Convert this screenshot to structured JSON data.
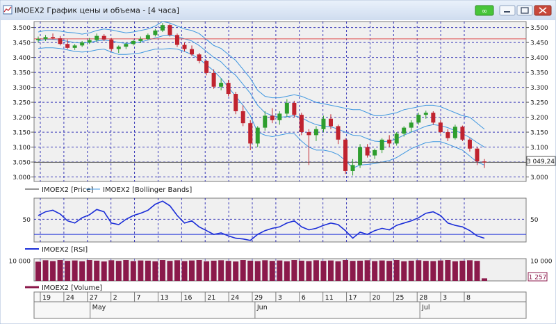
{
  "window": {
    "title": "IMOEX2 График цены и объема - [4 часа]",
    "colors": {
      "titlebar": "#ffffff",
      "frame": "#9fb6d6",
      "link_button": "#48c53a",
      "close_button": "#c8483a"
    }
  },
  "icons": {
    "app": "chart-window-icon",
    "link": "link-icon",
    "minimize": "minimize-icon",
    "maximize": "maximize-icon",
    "close": "close-icon"
  },
  "legend": {
    "price": "IMOEX2 [Price]",
    "bollinger": "IMOEX2 [Bollinger Bands]",
    "rsi": "IMOEX2 [RSI]",
    "volume": "IMOEX2 [Volume]"
  },
  "last_price_label": "3 049,24",
  "last_volume_label": "1 257",
  "colors": {
    "up_candle": "#2e9e2e",
    "down_candle": "#c0232f",
    "bollinger": "#3f97e0",
    "rsi": "#1a2dd8",
    "volume": "#8b1a4b",
    "grid": "#1c1cb0",
    "hline_price": "#e05050",
    "plot_bg": "#f0f0f0"
  },
  "chart_data": [
    {
      "type": "candlestick",
      "series": [
        {
          "name": "IMOEX2 [Price]",
          "values": [
            [
              3458,
              3470,
              3450,
              3462
            ],
            [
              3462,
              3475,
              3455,
              3468
            ],
            [
              3468,
              3480,
              3460,
              3464
            ],
            [
              3464,
              3472,
              3440,
              3445
            ],
            [
              3445,
              3460,
              3428,
              3432
            ],
            [
              3432,
              3445,
              3425,
              3440
            ],
            [
              3440,
              3455,
              3435,
              3450
            ],
            [
              3450,
              3465,
              3445,
              3458
            ],
            [
              3458,
              3480,
              3452,
              3472
            ],
            [
              3472,
              3478,
              3455,
              3460
            ],
            [
              3460,
              3465,
              3420,
              3428
            ],
            [
              3428,
              3440,
              3415,
              3436
            ],
            [
              3436,
              3450,
              3428,
              3445
            ],
            [
              3445,
              3460,
              3440,
              3455
            ],
            [
              3455,
              3470,
              3448,
              3462
            ],
            [
              3462,
              3480,
              3458,
              3475
            ],
            [
              3475,
              3495,
              3470,
              3490
            ],
            [
              3490,
              3515,
              3485,
              3508
            ],
            [
              3508,
              3512,
              3470,
              3475
            ],
            [
              3475,
              3480,
              3435,
              3442
            ],
            [
              3442,
              3450,
              3420,
              3428
            ],
            [
              3428,
              3440,
              3405,
              3410
            ],
            [
              3410,
              3415,
              3380,
              3388
            ],
            [
              3388,
              3392,
              3340,
              3348
            ],
            [
              3348,
              3360,
              3295,
              3302
            ],
            [
              3302,
              3330,
              3290,
              3315
            ],
            [
              3315,
              3325,
              3270,
              3278
            ],
            [
              3278,
              3285,
              3210,
              3220
            ],
            [
              3220,
              3240,
              3170,
              3180
            ],
            [
              3180,
              3190,
              3090,
              3112
            ],
            [
              3112,
              3170,
              3100,
              3165
            ],
            [
              3165,
              3220,
              3155,
              3205
            ],
            [
              3205,
              3230,
              3180,
              3190
            ],
            [
              3190,
              3220,
              3175,
              3212
            ],
            [
              3212,
              3260,
              3200,
              3248
            ],
            [
              3248,
              3255,
              3200,
              3208
            ],
            [
              3208,
              3215,
              3140,
              3150
            ],
            [
              3150,
              3160,
              3040,
              3140
            ],
            [
              3140,
              3170,
              3120,
              3160
            ],
            [
              3160,
              3205,
              3150,
              3195
            ],
            [
              3195,
              3210,
              3160,
              3170
            ],
            [
              3170,
              3175,
              3110,
              3125
            ],
            [
              3125,
              3130,
              3010,
              3020
            ],
            [
              3020,
              3060,
              3005,
              3040
            ],
            [
              3040,
              3110,
              3030,
              3100
            ],
            [
              3100,
              3110,
              3065,
              3072
            ],
            [
              3072,
              3095,
              3060,
              3090
            ],
            [
              3090,
              3130,
              3080,
              3125
            ],
            [
              3125,
              3140,
              3100,
              3112
            ],
            [
              3112,
              3150,
              3105,
              3145
            ],
            [
              3145,
              3170,
              3135,
              3165
            ],
            [
              3165,
              3190,
              3150,
              3182
            ],
            [
              3182,
              3215,
              3175,
              3208
            ],
            [
              3208,
              3222,
              3195,
              3215
            ],
            [
              3215,
              3220,
              3175,
              3182
            ],
            [
              3182,
              3190,
              3145,
              3150
            ],
            [
              3150,
              3160,
              3120,
              3130
            ],
            [
              3130,
              3175,
              3125,
              3168
            ],
            [
              3168,
              3172,
              3120,
              3125
            ],
            [
              3125,
              3130,
              3085,
              3095
            ],
            [
              3095,
              3100,
              3040,
              3052
            ],
            [
              3052,
              3060,
              3030,
              3049
            ]
          ]
        }
      ],
      "x_tick_labels": [
        "19",
        "24",
        "27",
        "2",
        "7",
        "13",
        "16",
        "21",
        "24",
        "29",
        "3",
        "6",
        "11",
        "17",
        "20",
        "25",
        "28",
        "3",
        "8"
      ],
      "month_labels": [
        "May",
        "Jun",
        "Jul"
      ],
      "y_ticks": [
        3000,
        3050,
        3100,
        3150,
        3200,
        3250,
        3300,
        3350,
        3400,
        3450,
        3500
      ],
      "y_tick_labels": [
        "3.000",
        "3.050",
        "3.100",
        "3.150",
        "3.200",
        "3.250",
        "3.300",
        "3.350",
        "3.400",
        "3.450",
        "3.500"
      ],
      "ylim": [
        2985,
        3520
      ],
      "horizontal_line": 3462,
      "last_value": 3049.24,
      "grid": true
    },
    {
      "type": "line",
      "series": [
        {
          "name": "IMOEX2 [Bollinger Bands]",
          "upper": [
            3485,
            3490,
            3490,
            3488,
            3484,
            3482,
            3478,
            3482,
            3490,
            3495,
            3492,
            3487,
            3482,
            3485,
            3490,
            3495,
            3505,
            3520,
            3515,
            3505,
            3495,
            3490,
            3480,
            3460,
            3440,
            3430,
            3410,
            3390,
            3360,
            3330,
            3290,
            3270,
            3265,
            3265,
            3270,
            3275,
            3270,
            3260,
            3250,
            3245,
            3240,
            3235,
            3230,
            3225,
            3225,
            3215,
            3205,
            3205,
            3210,
            3215,
            3225,
            3230,
            3235,
            3240,
            3240,
            3235,
            3225,
            3215,
            3205,
            3200,
            3180,
            3160
          ],
          "middle": [
            3455,
            3460,
            3460,
            3458,
            3454,
            3450,
            3448,
            3450,
            3455,
            3458,
            3455,
            3450,
            3447,
            3448,
            3452,
            3458,
            3465,
            3472,
            3474,
            3470,
            3462,
            3455,
            3440,
            3420,
            3400,
            3385,
            3360,
            3340,
            3310,
            3280,
            3240,
            3215,
            3205,
            3200,
            3202,
            3205,
            3198,
            3185,
            3175,
            3170,
            3168,
            3160,
            3150,
            3140,
            3138,
            3128,
            3120,
            3118,
            3120,
            3128,
            3140,
            3150,
            3160,
            3170,
            3175,
            3172,
            3165,
            3155,
            3145,
            3132,
            3115,
            3100
          ],
          "lower": [
            3430,
            3432,
            3432,
            3430,
            3425,
            3420,
            3418,
            3420,
            3425,
            3428,
            3418,
            3410,
            3410,
            3412,
            3415,
            3422,
            3428,
            3428,
            3430,
            3428,
            3420,
            3410,
            3395,
            3375,
            3355,
            3330,
            3300,
            3270,
            3240,
            3205,
            3150,
            3140,
            3135,
            3140,
            3145,
            3145,
            3120,
            3100,
            3090,
            3090,
            3085,
            3075,
            3055,
            3030,
            3040,
            3042,
            3045,
            3050,
            3055,
            3065,
            3080,
            3095,
            3105,
            3115,
            3118,
            3118,
            3110,
            3100,
            3090,
            3070,
            3050,
            3040
          ]
        }
      ]
    },
    {
      "type": "line",
      "series": [
        {
          "name": "IMOEX2 [RSI]",
          "values": [
            55,
            60,
            62,
            57,
            48,
            45,
            52,
            56,
            63,
            60,
            45,
            43,
            50,
            55,
            58,
            62,
            70,
            74,
            68,
            55,
            45,
            48,
            40,
            35,
            30,
            32,
            28,
            25,
            24,
            22,
            30,
            35,
            38,
            40,
            45,
            48,
            40,
            36,
            38,
            42,
            45,
            43,
            35,
            25,
            33,
            30,
            35,
            38,
            36,
            42,
            45,
            48,
            52,
            58,
            60,
            55,
            45,
            42,
            40,
            35,
            28,
            25
          ]
        }
      ],
      "y_ticks": [
        50
      ],
      "y_tick_labels": [
        "50"
      ],
      "ylim": [
        20,
        78
      ],
      "horizontal_line": 30,
      "grid": true
    },
    {
      "type": "bar",
      "series": [
        {
          "name": "IMOEX2 [Volume]",
          "values": [
            9500,
            10200,
            9800,
            10300,
            9900,
            10100,
            9700,
            10300,
            10000,
            9600,
            10200,
            9900,
            10300,
            9800,
            10100,
            10000,
            9700,
            10300,
            9900,
            10200,
            9800,
            10100,
            10300,
            9700,
            10000,
            10200,
            9900,
            9600,
            10300,
            10000,
            9800,
            10200,
            9900,
            10100,
            9700,
            10300,
            10000,
            9800,
            10200,
            9900,
            10100,
            9700,
            10300,
            9900,
            10000,
            10200,
            9800,
            10100,
            9900,
            10300,
            9700,
            10000,
            10200,
            9900,
            9800,
            10100,
            10300,
            9700,
            10000,
            10200,
            9900,
            1257
          ]
        }
      ],
      "y_ticks": [
        10000
      ],
      "y_tick_labels": [
        "10 000"
      ],
      "ylim": [
        0,
        11000
      ],
      "last_value": 1257
    }
  ]
}
